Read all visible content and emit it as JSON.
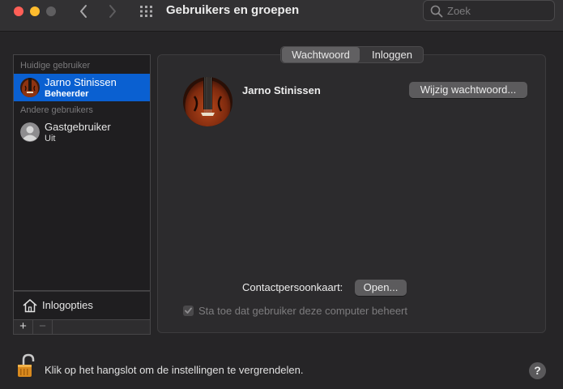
{
  "window": {
    "title": "Gebruikers en groepen",
    "search_placeholder": "Zoek"
  },
  "sidebar": {
    "current_header": "Huidige gebruiker",
    "other_header": "Andere gebruikers",
    "users": [
      {
        "name": "Jarno Stinissen",
        "role": "Beheerder",
        "selected": true
      },
      {
        "name": "Gastgebruiker",
        "role": "Uit",
        "selected": false
      }
    ],
    "login_options_label": "Inlogopties",
    "add_label": "+",
    "remove_label": "−"
  },
  "tabs": [
    {
      "label": "Wachtwoord",
      "active": true
    },
    {
      "label": "Inloggen",
      "active": false
    }
  ],
  "main": {
    "user_name": "Jarno Stinissen",
    "change_password_label": "Wijzig wachtwoord...",
    "contact_card_label": "Contactpersoonkaart:",
    "open_button_label": "Open...",
    "admin_checkbox_label": "Sta toe dat gebruiker deze computer beheert",
    "admin_checkbox_checked": true
  },
  "footer": {
    "lock_text": "Klik op het hangslot om de instellingen te vergrendelen.",
    "help_label": "?"
  },
  "colors": {
    "selection": "#0a60d1",
    "close": "#ff5f57",
    "minimize": "#febc2e"
  }
}
